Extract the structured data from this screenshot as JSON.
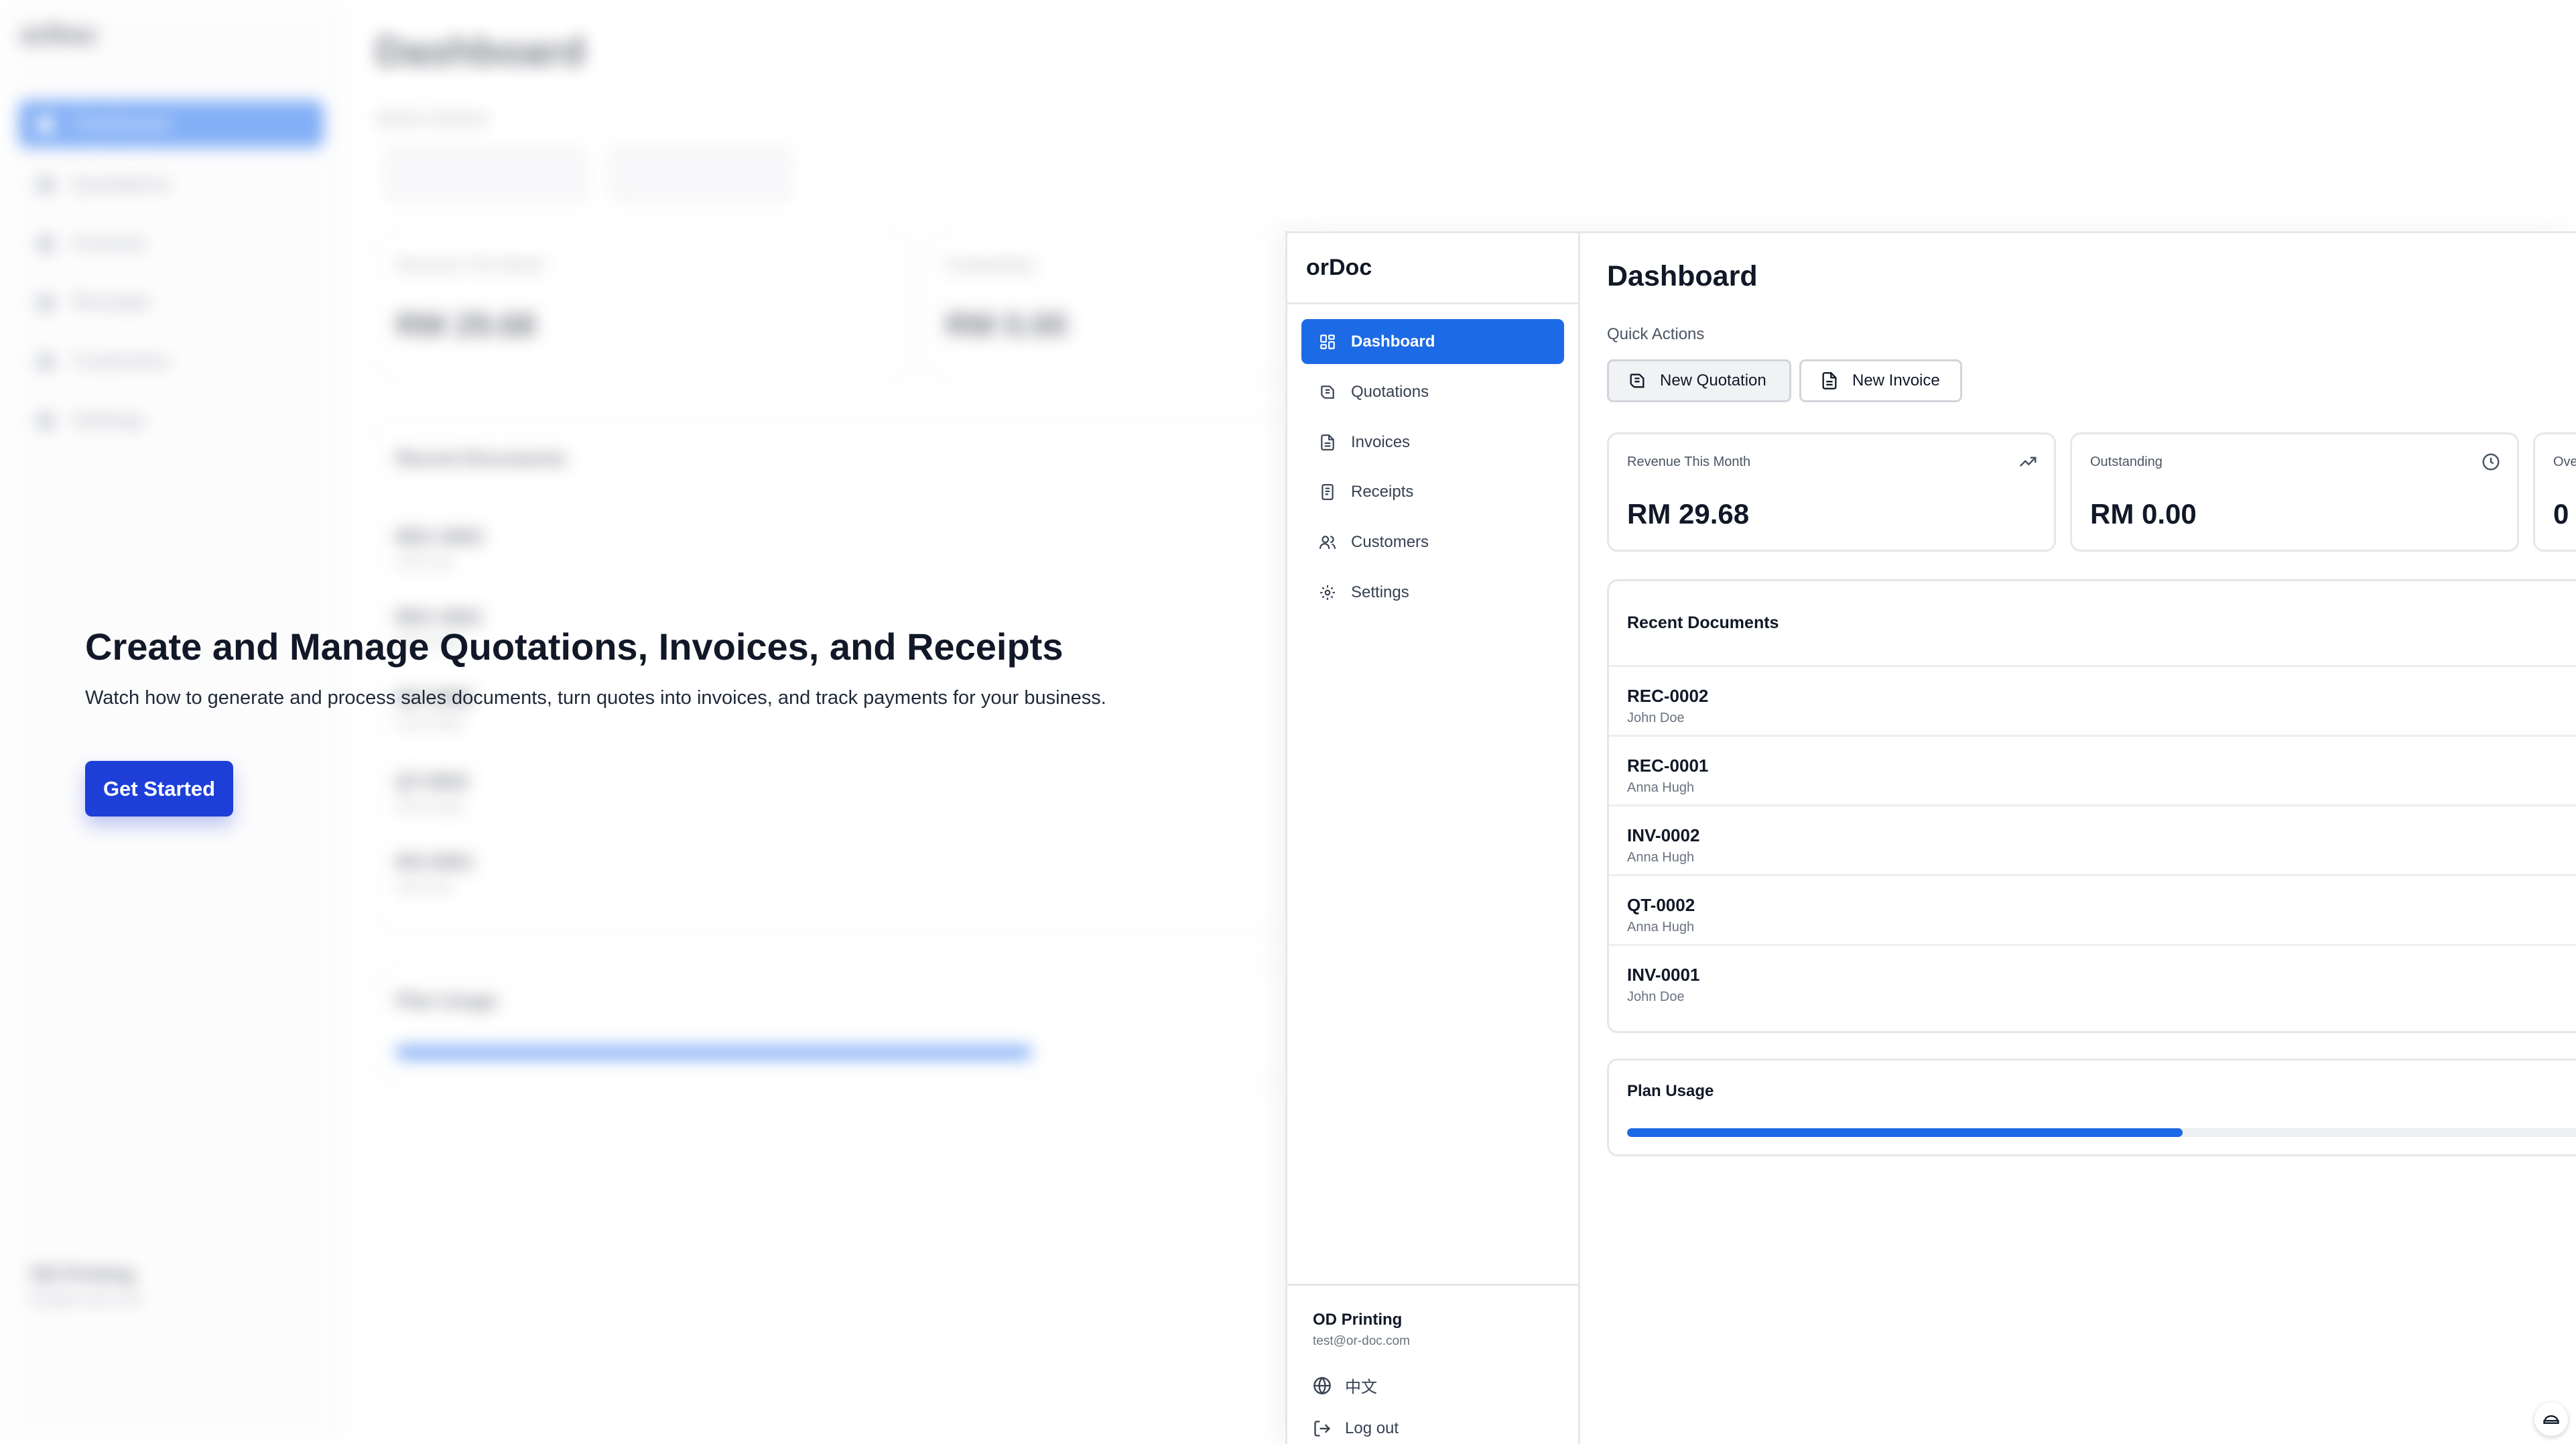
{
  "hero": {
    "title": "Create and Manage Quotations, Invoices, and Receipts",
    "description": "Watch how to generate and process sales documents, turn quotes into invoices, and track payments for your business.",
    "cta_label": "Get Started"
  },
  "app": {
    "brand": "orDoc",
    "nav": [
      {
        "label": "Dashboard",
        "icon": "dashboard-icon",
        "active": true
      },
      {
        "label": "Quotations",
        "icon": "quotation-icon",
        "active": false
      },
      {
        "label": "Invoices",
        "icon": "invoice-icon",
        "active": false
      },
      {
        "label": "Receipts",
        "icon": "receipt-icon",
        "active": false
      },
      {
        "label": "Customers",
        "icon": "users-icon",
        "active": false
      },
      {
        "label": "Settings",
        "icon": "gear-icon",
        "active": false
      }
    ],
    "footer": {
      "company": "OD Printing",
      "email": "test@or-doc.com",
      "language_label": "中文",
      "logout_label": "Log out"
    }
  },
  "dashboard": {
    "title": "Dashboard",
    "quick_actions_label": "Quick Actions",
    "quick_actions": [
      {
        "label": "New Quotation",
        "icon": "quotation-icon"
      },
      {
        "label": "New Invoice",
        "icon": "invoice-icon"
      }
    ],
    "stats": [
      {
        "label": "Revenue This Month",
        "value": "RM 29.68",
        "icon": "trending-up-icon"
      },
      {
        "label": "Outstanding",
        "value": "RM 0.00",
        "icon": "clock-icon"
      },
      {
        "label": "Ove",
        "value": "0",
        "icon": ""
      }
    ],
    "recent_title": "Recent Documents",
    "recent": [
      {
        "number": "REC-0002",
        "customer": "John Doe"
      },
      {
        "number": "REC-0001",
        "customer": "Anna Hugh"
      },
      {
        "number": "INV-0002",
        "customer": "Anna Hugh"
      },
      {
        "number": "QT-0002",
        "customer": "Anna Hugh"
      },
      {
        "number": "INV-0001",
        "customer": "John Doe"
      }
    ],
    "plan_title": "Plan Usage",
    "plan_usage_fraction": 0.56
  },
  "colors": {
    "primary": "#1c6ae6",
    "cta": "#1d3fd8",
    "text": "#111827",
    "muted": "#6b7280"
  }
}
